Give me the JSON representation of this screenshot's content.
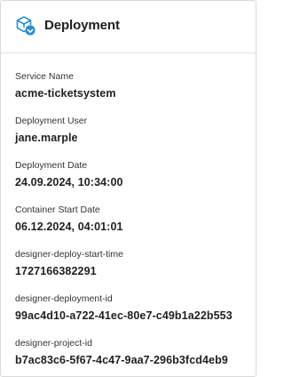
{
  "header": {
    "title": "Deployment",
    "icon": "deployment-cube-icon",
    "icon_color": "#2b8fd0"
  },
  "fields": [
    {
      "label": "Service Name",
      "value": "acme-ticketsystem"
    },
    {
      "label": "Deployment User",
      "value": "jane.marple"
    },
    {
      "label": "Deployment Date",
      "value": "24.09.2024, 10:34:00"
    },
    {
      "label": "Container Start Date",
      "value": "06.12.2024, 04:01:01"
    },
    {
      "label": "designer-deploy-start-time",
      "value": "1727166382291"
    },
    {
      "label": "designer-deployment-id",
      "value": "99ac4d10-a722-41ec-80e7-c49b1a22b553"
    },
    {
      "label": "designer-project-id",
      "value": "b7ac83c6-5f67-4c47-9aa7-296b3fcd4eb9"
    }
  ]
}
